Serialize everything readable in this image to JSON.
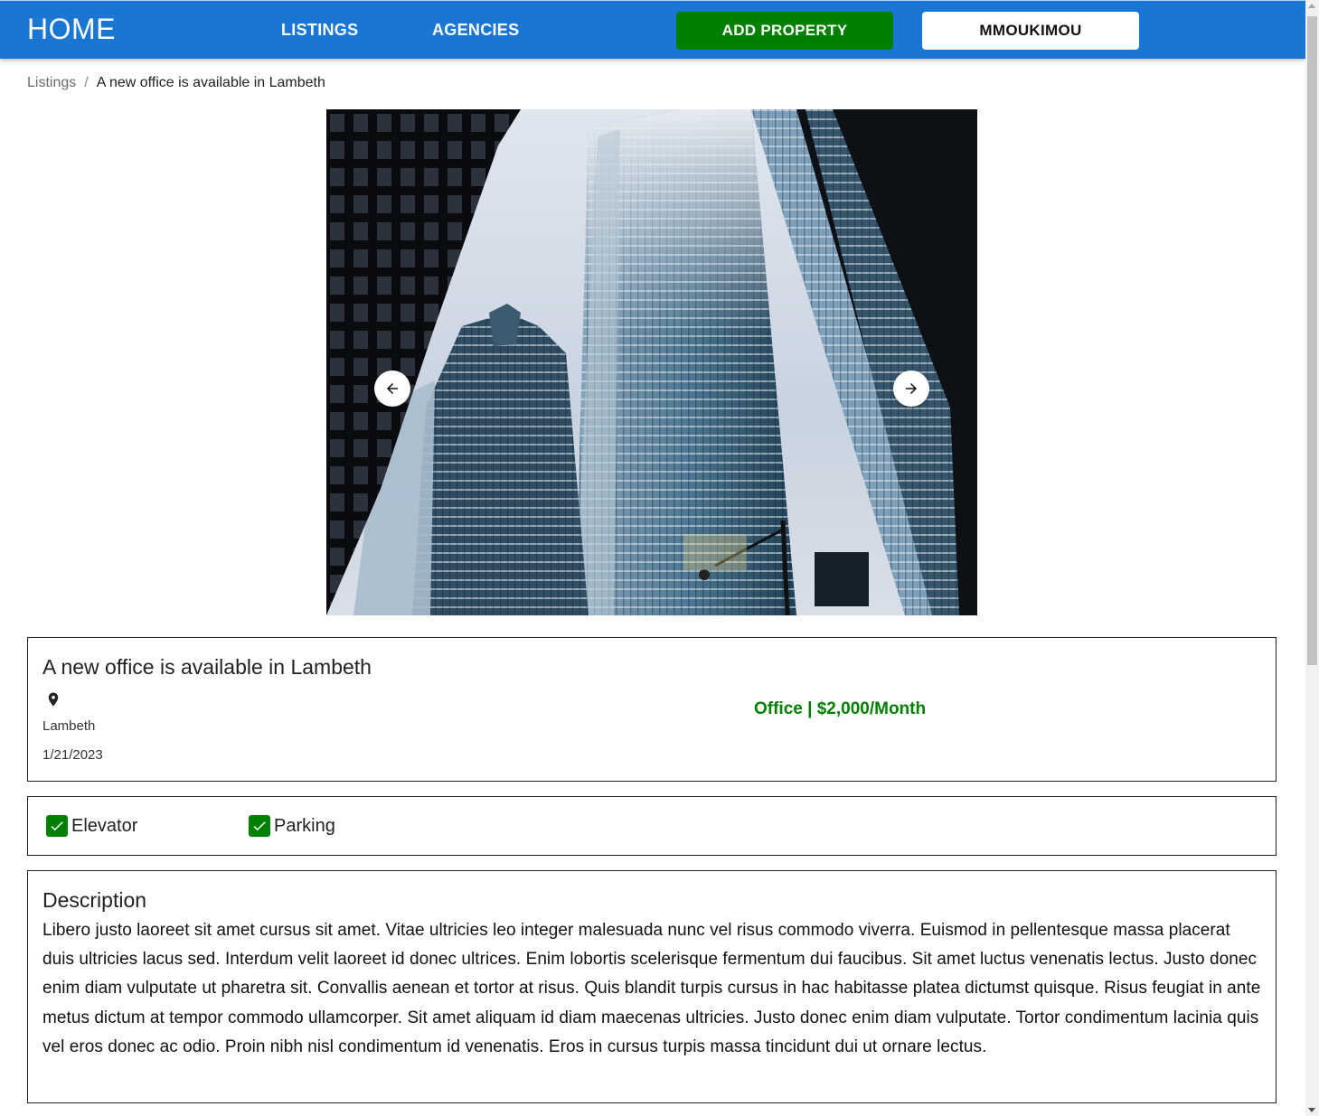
{
  "nav": {
    "home": "HOME",
    "listings": "LISTINGS",
    "agencies": "AGENCIES",
    "add_property": "ADD PROPERTY",
    "user": "MMOUKIMOU"
  },
  "breadcrumb": {
    "parent": "Listings",
    "separator": "/",
    "current": "A new office is available in Lambeth"
  },
  "listing": {
    "title": "A new office is available in Lambeth",
    "location": "Lambeth",
    "date": "1/21/2023",
    "type_price": "Office | $2,000/Month"
  },
  "features": [
    {
      "label": "Elevator",
      "checked": true
    },
    {
      "label": "Parking",
      "checked": true
    }
  ],
  "description": {
    "heading": "Description",
    "body": "Libero justo laoreet sit amet cursus sit amet. Vitae ultricies leo integer malesuada nunc vel risus commodo viverra. Euismod in pellentesque massa placerat duis ultricies lacus sed. Interdum velit laoreet id donec ultrices. Enim lobortis scelerisque fermentum dui faucibus. Sit amet luctus venenatis lectus. Justo donec enim diam vulputate ut pharetra sit. Convallis aenean et tortor at risus. Quis blandit turpis cursus in hac habitasse platea dictumst quisque. Risus feugiat in ante metus dictum at tempor commodo ullamcorper. Sit amet aliquam id diam maecenas ultricies. Justo donec enim diam vulputate. Tortor condimentum lacinia quis vel eros donec ac odio. Proin nibh nisl condimentum id venenatis. Eros in cursus turpis massa tincidunt dui ut ornare lectus."
  },
  "colors": {
    "appbar": "#1976d2",
    "add_button": "#008000",
    "price_text": "#008000",
    "check": "#008000"
  },
  "icons": {
    "location": "location-pin-icon",
    "prev": "arrow-left-icon",
    "next": "arrow-right-icon",
    "check": "checkbox-checked-icon"
  }
}
